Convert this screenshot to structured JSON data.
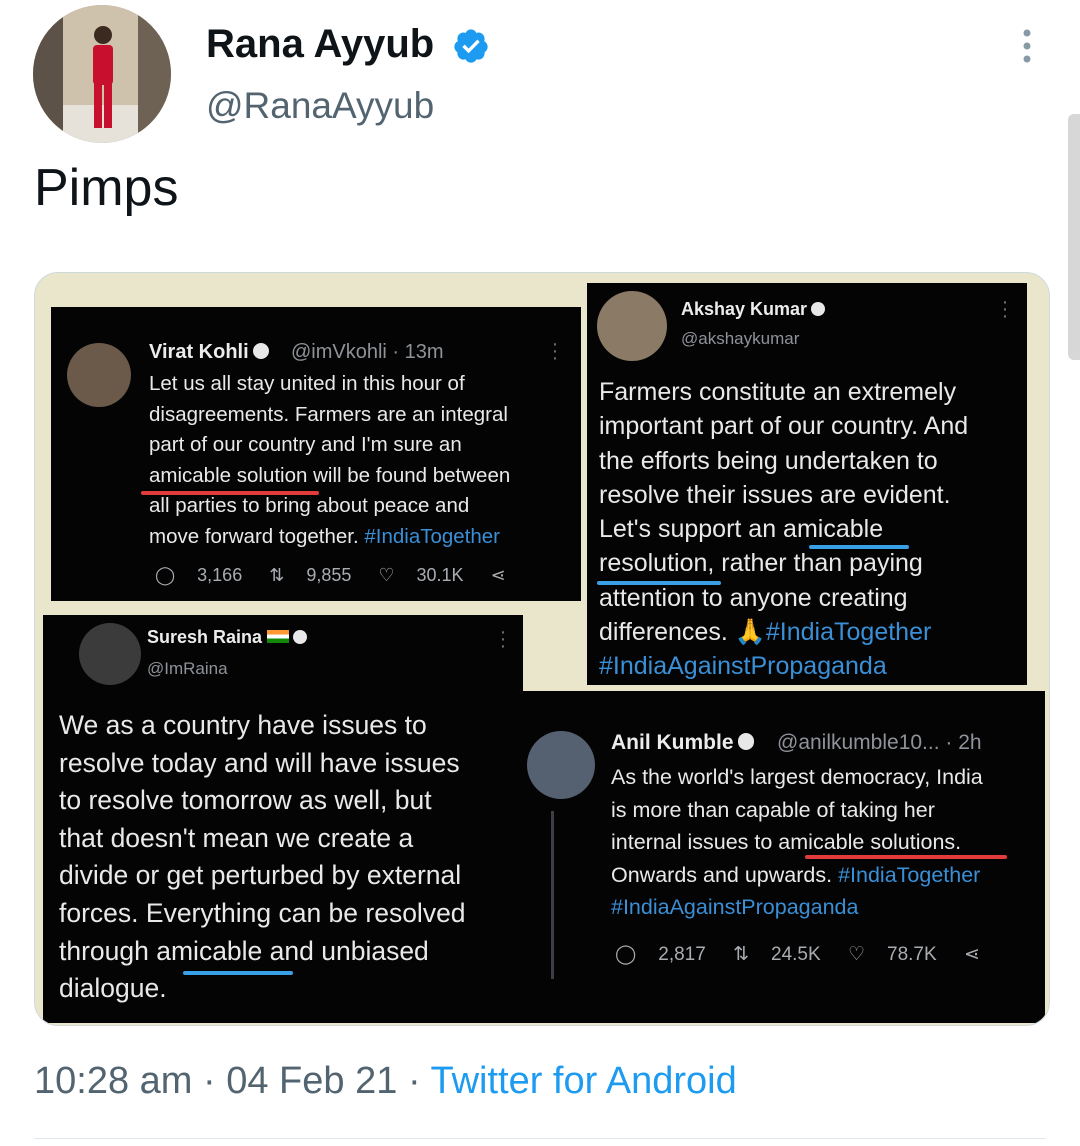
{
  "tweet": {
    "author_name": "Rana Ayyub",
    "author_handle": "@RanaAyyub",
    "text": "Pimps",
    "time": "10:28 am",
    "date": "04 Feb 21",
    "separator": "·",
    "source": "Twitter for Android"
  },
  "colors": {
    "link": "#1d9bf0",
    "verified": "#1d9bf0",
    "underline_red": "#e23b3b",
    "underline_blue": "#39a0e8"
  },
  "icons": [
    "verified-badge-icon",
    "more-options-icon",
    "reply-icon",
    "retweet-icon",
    "like-icon",
    "share-icon"
  ],
  "media": {
    "kohli": {
      "name": "Virat Kohli",
      "meta": "@imVkohli · 13m",
      "lines": [
        "Let us all stay united in this hour of",
        "disagreements. Farmers are an integral",
        "part of our country and I'm sure an",
        "amicable solution will be found between",
        "all parties to bring about peace and",
        "move forward together."
      ],
      "hashtag": "#IndiaTogether",
      "replies": "3,166",
      "retweets": "9,855",
      "likes": "30.1K"
    },
    "akshay": {
      "name": "Akshay Kumar",
      "handle": "@akshaykumar",
      "lines": [
        "Farmers constitute an extremely",
        "important part of our country. And",
        "the efforts being undertaken to",
        "resolve their issues are evident.",
        "Let's support an amicable",
        "resolution, rather than paying",
        "attention to anyone creating",
        "differences."
      ],
      "hashtag1": "#IndiaTogether",
      "hashtag2": "#IndiaAgainstPropaganda"
    },
    "raina": {
      "name": "Suresh Raina",
      "handle": "@ImRaina",
      "lines": [
        "We as a country have issues to",
        "resolve today and will have issues",
        "to resolve tomorrow as well, but",
        "that doesn't mean we create a",
        "divide or get perturbed by external",
        "forces. Everything can be resolved",
        "through amicable and unbiased",
        "dialogue."
      ]
    },
    "kumble": {
      "name": "Anil Kumble",
      "meta": "@anilkumble10... · 2h",
      "lines": [
        "As the world's largest democracy, India",
        "is more than capable of taking her",
        "internal issues to amicable solutions.",
        "Onwards and upwards."
      ],
      "hashtag1": "#IndiaTogether",
      "hashtag2": "#IndiaAgainstPropaganda",
      "replies": "2,817",
      "retweets": "24.5K",
      "likes": "78.7K"
    }
  }
}
